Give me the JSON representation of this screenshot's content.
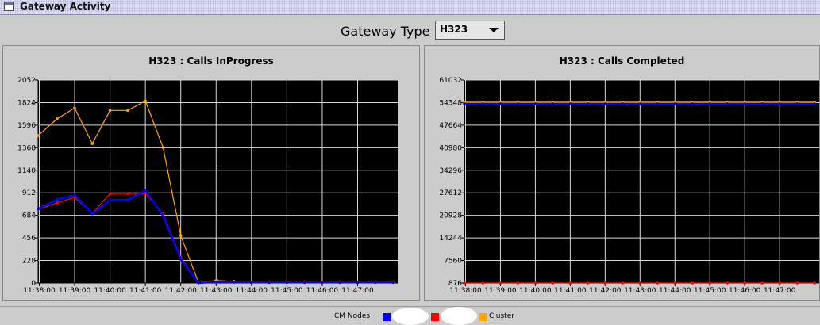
{
  "window": {
    "title": "Gateway Activity"
  },
  "gateway_type": {
    "label": "Gateway Type",
    "selected": "H323"
  },
  "legend": {
    "prefix": "CM Nodes",
    "cluster_label": "Cluster"
  },
  "colors": {
    "node1": "#0000ff",
    "node2": "#ff0000",
    "cluster": "#ffa500",
    "plot_bg": "#000000",
    "grid": "#ffffff"
  },
  "chart_data": [
    {
      "type": "line",
      "title": "H323 : Calls InProgress",
      "x_ticks": [
        "11:38:00",
        "11:39:00",
        "11:40:00",
        "11:41:00",
        "11:42:00",
        "11:43:00",
        "11:44:00",
        "11:45:00",
        "11:46:00",
        "11:47:00"
      ],
      "y_ticks": [
        "0",
        "228",
        "456",
        "684",
        "912",
        "1140",
        "1368",
        "1596",
        "1824",
        "2052"
      ],
      "xlim": [
        "11:37:58",
        "11:48:08"
      ],
      "ylim": [
        0,
        2052
      ],
      "series": [
        {
          "color": "#ffa500",
          "points": [
            [
              "11:37:58",
              1490
            ],
            [
              "11:38:30",
              1660
            ],
            [
              "11:39:00",
              1770
            ],
            [
              "11:39:30",
              1410
            ],
            [
              "11:40:00",
              1745
            ],
            [
              "11:40:30",
              1745
            ],
            [
              "11:41:00",
              1840
            ],
            [
              "11:41:30",
              1370
            ],
            [
              "11:42:00",
              480
            ],
            [
              "11:42:30",
              5
            ],
            [
              "11:43:00",
              25
            ],
            [
              "11:43:30",
              18
            ],
            [
              "11:44:00",
              12
            ],
            [
              "11:44:30",
              12
            ],
            [
              "11:45:00",
              12
            ],
            [
              "11:45:30",
              12
            ],
            [
              "11:46:00",
              12
            ],
            [
              "11:46:30",
              12
            ],
            [
              "11:47:00",
              12
            ],
            [
              "11:47:30",
              12
            ],
            [
              "11:48:00",
              12
            ]
          ]
        },
        {
          "color": "#ff0000",
          "points": [
            [
              "11:37:58",
              745
            ],
            [
              "11:38:30",
              810
            ],
            [
              "11:39:00",
              865
            ],
            [
              "11:39:30",
              705
            ],
            [
              "11:40:00",
              905
            ],
            [
              "11:40:30",
              905
            ],
            [
              "11:41:00",
              905
            ],
            [
              "11:41:30",
              700
            ],
            [
              "11:42:00",
              260
            ],
            [
              "11:42:30",
              2
            ],
            [
              "11:43:00",
              10
            ],
            [
              "11:43:30",
              8
            ],
            [
              "11:44:00",
              6
            ],
            [
              "11:44:30",
              6
            ],
            [
              "11:45:00",
              6
            ],
            [
              "11:45:30",
              6
            ],
            [
              "11:46:00",
              6
            ],
            [
              "11:46:30",
              6
            ],
            [
              "11:47:00",
              6
            ],
            [
              "11:47:30",
              6
            ],
            [
              "11:48:00",
              6
            ]
          ]
        },
        {
          "color": "#0000ff",
          "points": [
            [
              "11:37:58",
              750
            ],
            [
              "11:38:30",
              845
            ],
            [
              "11:39:00",
              890
            ],
            [
              "11:39:30",
              700
            ],
            [
              "11:40:00",
              840
            ],
            [
              "11:40:30",
              840
            ],
            [
              "11:41:00",
              935
            ],
            [
              "11:41:30",
              680
            ],
            [
              "11:42:00",
              240
            ],
            [
              "11:42:30",
              2
            ],
            [
              "11:43:00",
              10
            ],
            [
              "11:43:30",
              8
            ],
            [
              "11:44:00",
              6
            ],
            [
              "11:44:30",
              6
            ],
            [
              "11:45:00",
              6
            ],
            [
              "11:45:30",
              6
            ],
            [
              "11:46:00",
              6
            ],
            [
              "11:46:30",
              6
            ],
            [
              "11:47:00",
              6
            ],
            [
              "11:47:30",
              6
            ],
            [
              "11:48:00",
              6
            ]
          ]
        }
      ],
      "grid": true
    },
    {
      "type": "line",
      "title": "H323 : Calls Completed",
      "x_ticks": [
        "11:38:00",
        "11:39:00",
        "11:40:00",
        "11:41:00",
        "11:42:00",
        "11:43:00",
        "11:44:00",
        "11:45:00",
        "11:46:00",
        "11:47:00"
      ],
      "y_ticks": [
        "876",
        "7560",
        "14244",
        "20928",
        "27612",
        "34296",
        "40980",
        "47664",
        "54348",
        "61032"
      ],
      "xlim": [
        "11:37:58",
        "11:48:08"
      ],
      "ylim": [
        876,
        61032
      ],
      "series": [
        {
          "color": "#ffa500",
          "points": [
            [
              "11:37:58",
              54500
            ],
            [
              "11:38:30",
              54500
            ],
            [
              "11:39:00",
              54500
            ],
            [
              "11:39:30",
              54500
            ],
            [
              "11:40:00",
              54500
            ],
            [
              "11:40:30",
              54500
            ],
            [
              "11:41:00",
              54500
            ],
            [
              "11:41:30",
              54500
            ],
            [
              "11:42:00",
              54500
            ],
            [
              "11:42:30",
              54500
            ],
            [
              "11:43:00",
              54500
            ],
            [
              "11:43:30",
              54500
            ],
            [
              "11:44:00",
              54500
            ],
            [
              "11:44:30",
              54500
            ],
            [
              "11:45:00",
              54500
            ],
            [
              "11:45:30",
              54500
            ],
            [
              "11:46:00",
              54500
            ],
            [
              "11:46:30",
              54500
            ],
            [
              "11:47:00",
              54500
            ],
            [
              "11:47:30",
              54500
            ],
            [
              "11:48:00",
              54500
            ]
          ]
        },
        {
          "color": "#0000ff",
          "points": [
            [
              "11:37:58",
              54000
            ],
            [
              "11:38:30",
              54000
            ],
            [
              "11:39:00",
              54000
            ],
            [
              "11:39:30",
              54000
            ],
            [
              "11:40:00",
              54000
            ],
            [
              "11:40:30",
              54000
            ],
            [
              "11:41:00",
              54000
            ],
            [
              "11:41:30",
              54000
            ],
            [
              "11:42:00",
              54000
            ],
            [
              "11:42:30",
              54000
            ],
            [
              "11:43:00",
              54000
            ],
            [
              "11:43:30",
              54000
            ],
            [
              "11:44:00",
              54000
            ],
            [
              "11:44:30",
              54000
            ],
            [
              "11:45:00",
              54000
            ],
            [
              "11:45:30",
              54000
            ],
            [
              "11:46:00",
              54000
            ],
            [
              "11:46:30",
              54000
            ],
            [
              "11:47:00",
              54000
            ],
            [
              "11:47:30",
              54000
            ],
            [
              "11:48:00",
              54000
            ]
          ]
        },
        {
          "color": "#ff0000",
          "points": [
            [
              "11:37:58",
              876
            ],
            [
              "11:38:30",
              876
            ],
            [
              "11:39:00",
              876
            ],
            [
              "11:39:30",
              876
            ],
            [
              "11:40:00",
              876
            ],
            [
              "11:40:30",
              876
            ],
            [
              "11:41:00",
              876
            ],
            [
              "11:41:30",
              876
            ],
            [
              "11:42:00",
              876
            ],
            [
              "11:42:30",
              876
            ],
            [
              "11:43:00",
              876
            ],
            [
              "11:43:30",
              876
            ],
            [
              "11:44:00",
              876
            ],
            [
              "11:44:30",
              876
            ],
            [
              "11:45:00",
              876
            ],
            [
              "11:45:30",
              876
            ],
            [
              "11:46:00",
              876
            ],
            [
              "11:46:30",
              876
            ],
            [
              "11:47:00",
              876
            ],
            [
              "11:47:30",
              876
            ],
            [
              "11:48:00",
              876
            ]
          ]
        }
      ],
      "grid": true
    }
  ]
}
